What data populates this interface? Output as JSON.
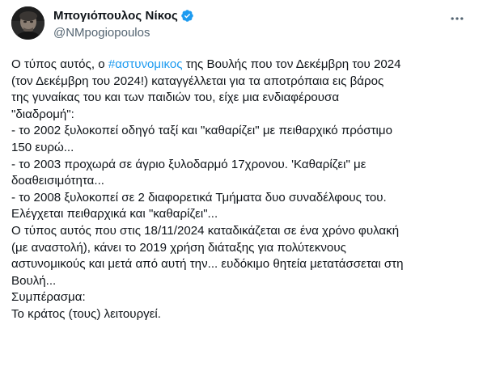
{
  "author": {
    "display_name": "Μπογιόπουλος Νίκος",
    "handle": "@NMpogiopoulos",
    "verified": true,
    "verified_color": "#1d9bf0"
  },
  "menu_icon": "more-horizontal-icon",
  "post": {
    "line_1_before": "Ο τύπος αυτός, ο ",
    "hashtag": "#αστυνομικος",
    "line_1_after": " της Βουλής που τον Δεκέμβρη του 2024",
    "lines": [
      "(τον Δεκέμβρη του 2024!) καταγγέλλεται για τα αποτρόπαια εις βάρος",
      "της γυναίκας του και των παιδιών του, είχε μια ενδιαφέρουσα",
      "\"διαδρομή\":",
      "- το 2002 ξυλοκοπεί  οδηγό ταξί και \"καθαρίζει\" με πειθαρχικό πρόστιμο",
      "150 ευρώ...",
      "- το 2003 προχωρά σε άγριο ξυλοδαρμό 17χρονου. 'Καθαρίζει\" με",
      "δοαθεισιμότητα...",
      "- το 2008 ξυλοκοπεί σε 2 διαφορετικά Τμήματα δυο συναδέλφους του.",
      "Ελέγχεται πειθαρχικά και \"καθαρίζει\"...",
      "Ο τύπος αυτός που στις 18/11/2024 καταδικάζεται σε ένα χρόνο φυλακή",
      "(με αναστολή), κάνει το 2019 χρήση διάταξης για πολύτεκνους",
      "αστυνομικούς και μετά από αυτή την... ευδόκιμο θητεία μετατάσσεται στη",
      "Βουλή...",
      "Συμπέρασμα:",
      "Το κράτος (τους) λειτουργεί."
    ]
  },
  "colors": {
    "text": "#0f1419",
    "secondary": "#536471",
    "link": "#1d9bf0"
  }
}
